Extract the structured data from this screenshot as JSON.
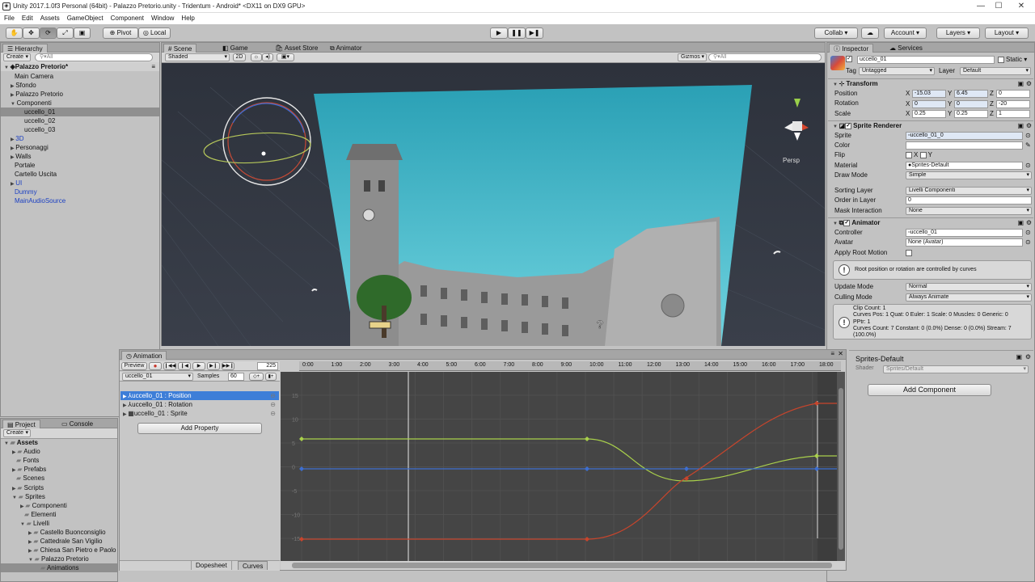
{
  "window": {
    "title": "Unity 2017.1.0f3 Personal (64bit) - Palazzo Pretorio.unity - Tridentum - Android* <DX11 on DX9 GPU>",
    "minimize": "—",
    "maximize": "☐",
    "close": "✕"
  },
  "menu": [
    "File",
    "Edit",
    "Assets",
    "GameObject",
    "Component",
    "Window",
    "Help"
  ],
  "toolbar": {
    "pivot": "Pivot",
    "local": "Local",
    "collab": "Collab ▾",
    "account": "Account",
    "layers": "Layers",
    "layout": "Layout"
  },
  "hierarchy": {
    "tab": "Hierarchy",
    "create": "Create",
    "search": "All",
    "scene": "Palazzo Pretorio*",
    "items": [
      {
        "label": "Main Camera",
        "indent": 1,
        "arrow": "",
        "cls": ""
      },
      {
        "label": "Sfondo",
        "indent": 1,
        "arrow": "▶",
        "cls": ""
      },
      {
        "label": "Palazzo Pretorio",
        "indent": 1,
        "arrow": "▶",
        "cls": ""
      },
      {
        "label": "Componenti",
        "indent": 1,
        "arrow": "▼",
        "cls": ""
      },
      {
        "label": "uccello_01",
        "indent": 2,
        "arrow": "",
        "cls": "sel"
      },
      {
        "label": "uccello_02",
        "indent": 2,
        "arrow": "",
        "cls": ""
      },
      {
        "label": "uccello_03",
        "indent": 2,
        "arrow": "",
        "cls": ""
      },
      {
        "label": "3D",
        "indent": 1,
        "arrow": "▶",
        "cls": "blue"
      },
      {
        "label": "Personaggi",
        "indent": 1,
        "arrow": "▶",
        "cls": ""
      },
      {
        "label": "Walls",
        "indent": 1,
        "arrow": "▶",
        "cls": ""
      },
      {
        "label": "Portale",
        "indent": 1,
        "arrow": "",
        "cls": ""
      },
      {
        "label": "Cartello Uscita",
        "indent": 1,
        "arrow": "",
        "cls": ""
      },
      {
        "label": "UI",
        "indent": 1,
        "arrow": "▶",
        "cls": "blue"
      },
      {
        "label": "Dummy",
        "indent": 1,
        "arrow": "",
        "cls": "blue"
      },
      {
        "label": "MainAudioSource",
        "indent": 1,
        "arrow": "",
        "cls": "blue"
      }
    ]
  },
  "scene_tabs": [
    "Scene",
    "Game",
    "Asset Store",
    "Animator"
  ],
  "scene_bar": {
    "shaded": "Shaded",
    "twod": "2D",
    "gizmos": "Gizmos",
    "search": "All",
    "persp": "Persp"
  },
  "project": {
    "tabs": [
      "Project",
      "Console"
    ],
    "create": "Create",
    "items": [
      {
        "label": "Assets",
        "indent": 0,
        "arrow": "▼",
        "bold": true
      },
      {
        "label": "Audio",
        "indent": 1,
        "arrow": "▶"
      },
      {
        "label": "Fonts",
        "indent": 1,
        "arrow": ""
      },
      {
        "label": "Prefabs",
        "indent": 1,
        "arrow": "▶"
      },
      {
        "label": "Scenes",
        "indent": 1,
        "arrow": ""
      },
      {
        "label": "Scripts",
        "indent": 1,
        "arrow": "▶"
      },
      {
        "label": "Sprites",
        "indent": 1,
        "arrow": "▼"
      },
      {
        "label": "Componenti",
        "indent": 2,
        "arrow": "▶"
      },
      {
        "label": "Elementi",
        "indent": 2,
        "arrow": ""
      },
      {
        "label": "Livelli",
        "indent": 2,
        "arrow": "▼"
      },
      {
        "label": "Castello Buonconsiglio",
        "indent": 3,
        "arrow": "▶"
      },
      {
        "label": "Cattedrale San Vigilio",
        "indent": 3,
        "arrow": "▶"
      },
      {
        "label": "Chiesa San Pietro e Paolo",
        "indent": 3,
        "arrow": "▶"
      },
      {
        "label": "Palazzo Pretorio",
        "indent": 3,
        "arrow": "▼"
      },
      {
        "label": "Animations",
        "indent": 4,
        "arrow": "",
        "sel": true
      }
    ]
  },
  "animation": {
    "tab": "Animation",
    "preview": "Preview",
    "frame": "225",
    "clip": "uccello_01",
    "samples_label": "Samples",
    "samples": "60",
    "properties": [
      "uccello_01 : Position",
      "uccello_01 : Rotation",
      "uccello_01 : Sprite"
    ],
    "add_property": "Add Property",
    "dopesheet": "Dopesheet",
    "curves": "Curves",
    "ticks": [
      "0:00",
      "1:00",
      "2:00",
      "3:00",
      "4:00",
      "5:00",
      "6:00",
      "7:00",
      "8:00",
      "9:00",
      "10:00",
      "11:00",
      "12:00",
      "13:00",
      "14:00",
      "15:00",
      "16:00",
      "17:00",
      "18:00"
    ],
    "yticks": [
      "15",
      "10",
      "5",
      "0",
      "-5",
      "-10",
      "-15"
    ]
  },
  "inspector": {
    "tabs": [
      "Inspector",
      "Services"
    ],
    "name": "uccello_01",
    "static": "Static",
    "tag_label": "Tag",
    "tag": "Untagged",
    "layer_label": "Layer",
    "layer": "Default",
    "transform": {
      "title": "Transform",
      "position": "Position",
      "rotation": "Rotation",
      "scale": "Scale",
      "px": "-15.03",
      "py": "6.45",
      "pz": "0",
      "rx": "0",
      "ry": "0",
      "rz": "-20",
      "sx": "0.25",
      "sy": "0.25",
      "sz": "1"
    },
    "sprite_renderer": {
      "title": "Sprite Renderer",
      "sprite_label": "Sprite",
      "sprite": "uccello_01_0",
      "color_label": "Color",
      "flip_label": "Flip",
      "flip_x": "X",
      "flip_y": "Y",
      "material_label": "Material",
      "material": "Sprites-Default",
      "draw_label": "Draw Mode",
      "draw": "Simple",
      "sorting_label": "Sorting Layer",
      "sorting": "Livelli Componenti",
      "order_label": "Order in Layer",
      "order": "0",
      "mask_label": "Mask Interaction",
      "mask": "None"
    },
    "animator": {
      "title": "Animator",
      "controller_label": "Controller",
      "controller": "uccello_01",
      "avatar_label": "Avatar",
      "avatar": "None (Avatar)",
      "root_label": "Apply Root Motion",
      "info": "Root position or rotation are controlled by curves",
      "update_label": "Update Mode",
      "update": "Normal",
      "culling_label": "Culling Mode",
      "culling": "Always Animate",
      "clip_info": [
        "Clip Count: 1",
        "Curves Pos: 1 Quat: 0 Euler: 1 Scale: 0 Muscles: 0 Generic: 0",
        "PPtr: 1",
        "Curves Count: 7 Constant: 0 (0.0%) Dense: 0 (0.0%) Stream: 7",
        "(100.0%)"
      ]
    },
    "material": {
      "name": "Sprites-Default",
      "shader_label": "Shader",
      "shader": "Sprites/Default"
    },
    "add_component": "Add Component"
  },
  "colors": {
    "sky": "#3fb7c9",
    "selection": "#3d7ed8",
    "curve_red": "#c8452c",
    "curve_green": "#a9d04b",
    "curve_blue": "#3d6fd1"
  }
}
